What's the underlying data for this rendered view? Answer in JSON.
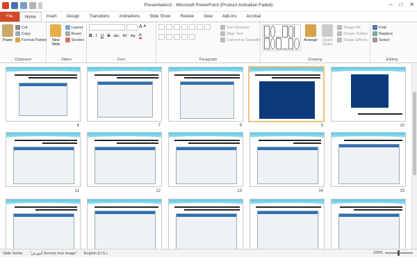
{
  "window": {
    "title": "Presentation1 - Microsoft PowerPoint (Product Activation Failed)",
    "minimize_glyph": "–",
    "maximize_glyph": "□",
    "close_glyph": "✕"
  },
  "ribbon_tabs": [
    "File",
    "Home",
    "Insert",
    "Design",
    "Transitions",
    "Animations",
    "Slide Show",
    "Review",
    "View",
    "Add-Ins",
    "Acrobat"
  ],
  "clipboard": {
    "paste": "Paste",
    "cut": "Cut",
    "copy": "Copy",
    "format_painter": "Format Painter",
    "label": "Clipboard"
  },
  "slides_group": {
    "new_slide": "New Slide",
    "layout": "Layout",
    "reset": "Reset",
    "section": "Section",
    "label": "Slides"
  },
  "font_group": {
    "label": "Font",
    "bold": "B",
    "italic": "I",
    "underline": "U",
    "strike": "S",
    "shadow": "abc",
    "spacing": "AV",
    "case": "Aa",
    "color": "A",
    "grow": "A",
    "shrink": "A"
  },
  "paragraph_group": {
    "label": "Paragraph",
    "text_direction": "Text Direction",
    "align_text": "Align Text",
    "convert_smartart": "Convert to SmartArt"
  },
  "drawing_group": {
    "label": "Drawing",
    "arrange": "Arrange",
    "quick_styles": "Quick Styles",
    "shape_fill": "Shape Fill",
    "shape_outline": "Shape Outline",
    "shape_effects": "Shape Effects"
  },
  "editing_group": {
    "label": "Editing",
    "find": "Find",
    "replace": "Replace",
    "select": "Select"
  },
  "slide_numbers": [
    "6",
    "7",
    "8",
    "9",
    "10",
    "11",
    "12",
    "13",
    "14",
    "15"
  ],
  "status": {
    "view": "Slide Sorter",
    "theme": "\"آموزش Acronis true image\"",
    "language": "English (U.S.)",
    "zoom": "100%"
  },
  "colors": {
    "file_tab": "#d24726",
    "accent": "#2b579a",
    "band": "#5bc8e6",
    "selected_border": "#f0c27a"
  }
}
